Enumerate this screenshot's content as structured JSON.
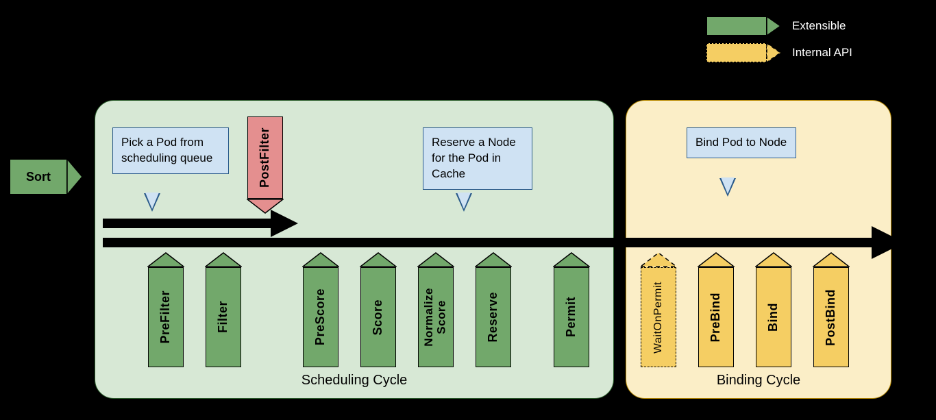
{
  "legend": {
    "extensible": "Extensible",
    "internal": "Internal API"
  },
  "sort": "Sort",
  "cycles": {
    "scheduling": "Scheduling Cycle",
    "binding": "Binding Cycle"
  },
  "callouts": {
    "pick": "Pick a Pod from scheduling queue",
    "reserve": "Reserve a Node for the Pod in Cache",
    "bind": "Bind Pod to Node"
  },
  "extensions": {
    "prefilter": "PreFilter",
    "filter": "Filter",
    "postfilter": "PostFilter",
    "prescore": "PreScore",
    "score": "Score",
    "normalizescore": "Normalize\nScore",
    "reserve": "Reserve",
    "permit": "Permit",
    "waitonpermit": "WaitOnPermit",
    "prebind": "PreBind",
    "bind": "Bind",
    "postbind": "PostBind"
  }
}
